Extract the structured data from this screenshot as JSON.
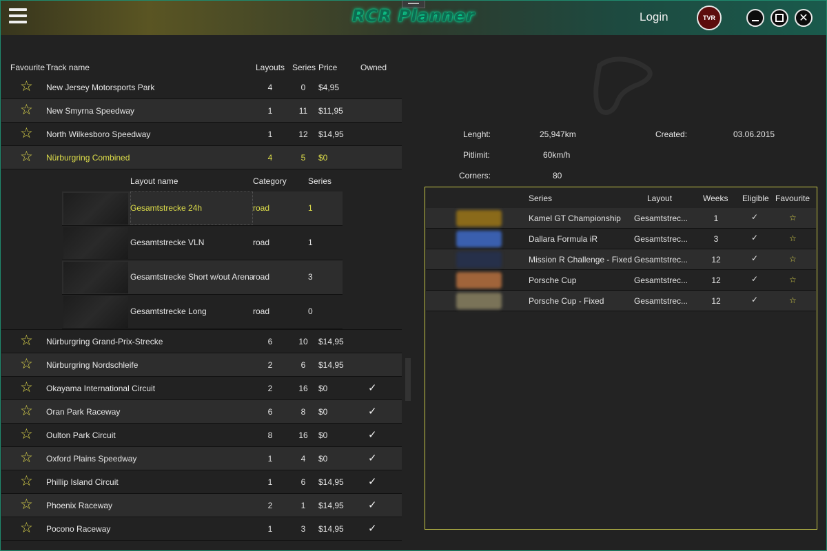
{
  "app": {
    "title": "RCR Planner",
    "login_label": "Login",
    "avatar_text": "TVR",
    "close_glyph": "✕",
    "icons": {
      "menu": "hamburger-icon",
      "favourite": "star-icon",
      "owned": "check-icon"
    }
  },
  "tracks": {
    "headers": {
      "favourite": "Favourite",
      "name": "Track name",
      "layouts": "Layouts",
      "series": "Series",
      "price": "Price",
      "owned": "Owned"
    },
    "rows_before": [
      {
        "name": "New Jersey Motorsports Park",
        "layouts": "4",
        "series": "0",
        "price": "$4,95",
        "owned": ""
      },
      {
        "name": "New Smyrna Speedway",
        "layouts": "1",
        "series": "11",
        "price": "$11,95",
        "owned": ""
      },
      {
        "name": "North Wilkesboro Speedway",
        "layouts": "1",
        "series": "12",
        "price": "$14,95",
        "owned": ""
      },
      {
        "name": "Nürburgring Combined",
        "layouts": "4",
        "series": "5",
        "price": "$0",
        "owned": ""
      }
    ],
    "layout_headers": {
      "name": "Layout name",
      "category": "Category",
      "series": "Series"
    },
    "layouts": [
      {
        "name": "Gesamtstrecke 24h",
        "category": "road",
        "series": "1"
      },
      {
        "name": "Gesamtstrecke VLN",
        "category": "road",
        "series": "1"
      },
      {
        "name": "Gesamtstrecke Short w/out Arena",
        "category": "road",
        "series": "3"
      },
      {
        "name": "Gesamtstrecke Long",
        "category": "road",
        "series": "0"
      }
    ],
    "rows_after": [
      {
        "name": "Nürburgring Grand-Prix-Strecke",
        "layouts": "6",
        "series": "10",
        "price": "$14,95",
        "owned": ""
      },
      {
        "name": "Nürburgring Nordschleife",
        "layouts": "2",
        "series": "6",
        "price": "$14,95",
        "owned": ""
      },
      {
        "name": "Okayama International Circuit",
        "layouts": "2",
        "series": "16",
        "price": "$0",
        "owned": "✓"
      },
      {
        "name": "Oran Park Raceway",
        "layouts": "6",
        "series": "8",
        "price": "$0",
        "owned": "✓"
      },
      {
        "name": "Oulton Park Circuit",
        "layouts": "8",
        "series": "16",
        "price": "$0",
        "owned": "✓"
      },
      {
        "name": "Oxford Plains Speedway",
        "layouts": "1",
        "series": "4",
        "price": "$0",
        "owned": "✓"
      },
      {
        "name": "Phillip Island Circuit",
        "layouts": "1",
        "series": "6",
        "price": "$14,95",
        "owned": "✓"
      },
      {
        "name": "Phoenix Raceway",
        "layouts": "2",
        "series": "1",
        "price": "$14,95",
        "owned": "✓"
      },
      {
        "name": "Pocono Raceway",
        "layouts": "1",
        "series": "3",
        "price": "$14,95",
        "owned": "✓"
      }
    ]
  },
  "details": {
    "length_label": "Lenght:",
    "length_value": "25,947km",
    "created_label": "Created:",
    "created_value": "03.06.2015",
    "pitlimit_label": "Pitlimit:",
    "pitlimit_value": "60km/h",
    "corners_label": "Corners:",
    "corners_value": "80"
  },
  "series_table": {
    "headers": {
      "series": "Series",
      "layout": "Layout",
      "weeks": "Weeks",
      "eligible": "Eligible",
      "favourite": "Favourite"
    },
    "rows": [
      {
        "series": "Kamel GT Championship",
        "layout": "Gesamtstrec...",
        "weeks": "1",
        "eligible": "✓",
        "favourite": "☆",
        "logo_color": "#8a6a1a"
      },
      {
        "series": "Dallara Formula iR",
        "layout": "Gesamtstrec...",
        "weeks": "3",
        "eligible": "✓",
        "favourite": "☆",
        "logo_color": "#3a5fae"
      },
      {
        "series": "Mission R Challenge - Fixed",
        "layout": "Gesamtstrec...",
        "weeks": "12",
        "eligible": "✓",
        "favourite": "☆",
        "logo_color": "#26304a"
      },
      {
        "series": "Porsche Cup",
        "layout": "Gesamtstrec...",
        "weeks": "12",
        "eligible": "✓",
        "favourite": "☆",
        "logo_color": "#a0643a"
      },
      {
        "series": "Porsche Cup - Fixed",
        "layout": "Gesamtstrec...",
        "weeks": "12",
        "eligible": "✓",
        "favourite": "☆",
        "logo_color": "#7a7358"
      }
    ]
  }
}
